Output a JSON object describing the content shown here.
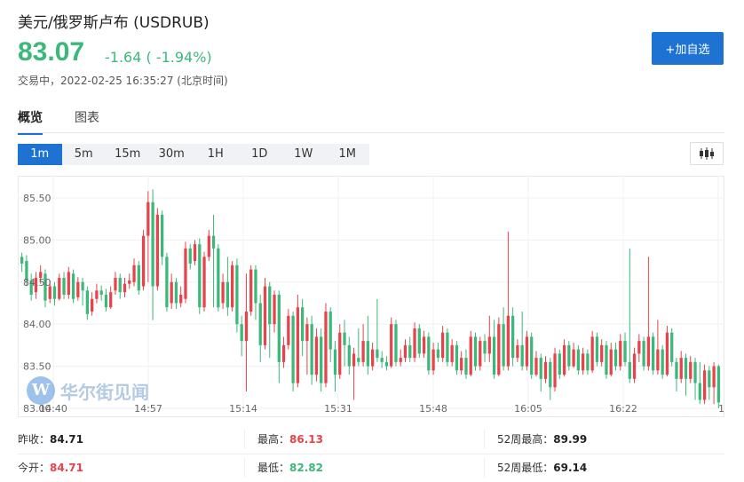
{
  "header": {
    "title": "美元/俄罗斯卢布  (USDRUB)",
    "price": "83.07",
    "change": "-1.64 ( -1.94%)",
    "status": "交易中，2022-02-25 16:35:27 (北京时间)",
    "add_button": "+加自选"
  },
  "tabs": [
    {
      "label": "概览",
      "active": true
    },
    {
      "label": "图表",
      "active": false
    }
  ],
  "periods": [
    {
      "label": "1m",
      "active": true
    },
    {
      "label": "5m",
      "active": false
    },
    {
      "label": "15m",
      "active": false
    },
    {
      "label": "30m",
      "active": false
    },
    {
      "label": "1H",
      "active": false
    },
    {
      "label": "1D",
      "active": false
    },
    {
      "label": "1W",
      "active": false
    },
    {
      "label": "1M",
      "active": false
    }
  ],
  "watermark": {
    "logo": "W",
    "text": "华尔街见闻"
  },
  "stats": {
    "prev_close_label": "昨收：",
    "prev_close": "84.71",
    "high_label": "最高：",
    "high": "86.13",
    "high52_label": "52周最高：",
    "high52": "89.99",
    "open_label": "今开：",
    "open": "84.71",
    "low_label": "最低：",
    "low": "82.82",
    "low52_label": "52周最低：",
    "low52": "69.14"
  },
  "colors": {
    "up": "#e8424a",
    "down": "#3bb87a",
    "accent": "#1e73d2"
  },
  "chart_data": {
    "type": "candlestick",
    "ylim": [
      83.0,
      85.7
    ],
    "y_ticks": [
      "85.50",
      "85.00",
      "84.50",
      "84.00",
      "83.50",
      "83.00"
    ],
    "x_ticks": [
      "14:40",
      "14:57",
      "15:14",
      "15:31",
      "15:48",
      "16:05",
      "16:22",
      "16:3"
    ],
    "grid": true,
    "candles": [
      [
        84.8,
        84.72,
        84.85,
        84.62
      ],
      [
        84.75,
        84.52,
        84.82,
        84.45
      ],
      [
        84.52,
        84.35,
        84.6,
        84.28
      ],
      [
        84.38,
        84.55,
        84.62,
        84.3
      ],
      [
        84.55,
        84.62,
        84.7,
        84.48
      ],
      [
        84.6,
        84.28,
        84.65,
        84.2
      ],
      [
        84.3,
        84.45,
        84.52,
        84.25
      ],
      [
        84.45,
        84.3,
        84.5,
        84.22
      ],
      [
        84.3,
        84.55,
        84.6,
        84.28
      ],
      [
        84.55,
        84.35,
        84.62,
        84.3
      ],
      [
        84.35,
        84.62,
        84.68,
        84.3
      ],
      [
        84.6,
        84.3,
        84.65,
        84.25
      ],
      [
        84.32,
        84.5,
        84.56,
        84.28
      ],
      [
        84.5,
        84.4,
        84.55,
        84.22
      ],
      [
        84.4,
        84.12,
        84.45,
        84.05
      ],
      [
        84.15,
        84.3,
        84.38,
        84.1
      ],
      [
        84.3,
        84.4,
        84.48,
        84.25
      ],
      [
        84.4,
        84.35,
        84.46,
        84.28
      ],
      [
        84.35,
        84.2,
        84.42,
        84.15
      ],
      [
        84.2,
        84.38,
        84.45,
        84.18
      ],
      [
        84.4,
        84.55,
        84.62,
        84.35
      ],
      [
        84.55,
        84.38,
        84.6,
        84.3
      ],
      [
        84.38,
        84.48,
        84.55,
        84.32
      ],
      [
        84.48,
        84.52,
        84.6,
        84.42
      ],
      [
        84.5,
        84.7,
        84.78,
        84.45
      ],
      [
        84.7,
        84.4,
        84.75,
        84.35
      ],
      [
        84.45,
        85.05,
        85.12,
        84.4
      ],
      [
        85.05,
        85.45,
        85.58,
        84.5
      ],
      [
        85.45,
        84.45,
        85.6,
        84.05
      ],
      [
        84.45,
        85.3,
        85.38,
        84.4
      ],
      [
        85.3,
        84.8,
        85.35,
        84.7
      ],
      [
        84.8,
        84.2,
        84.85,
        84.15
      ],
      [
        84.25,
        84.5,
        84.6,
        84.18
      ],
      [
        84.5,
        84.25,
        84.55,
        84.18
      ],
      [
        84.25,
        84.35,
        84.45,
        84.2
      ],
      [
        84.3,
        84.9,
        84.98,
        84.25
      ],
      [
        84.9,
        84.72,
        84.95,
        84.65
      ],
      [
        84.75,
        84.95,
        85.0,
        84.7
      ],
      [
        84.95,
        84.2,
        85.02,
        84.12
      ],
      [
        84.2,
        84.8,
        84.86,
        84.15
      ],
      [
        84.8,
        85.05,
        85.12,
        84.75
      ],
      [
        85.05,
        84.9,
        85.3,
        84.2
      ],
      [
        84.9,
        84.2,
        84.95,
        84.15
      ],
      [
        84.25,
        84.5,
        84.6,
        84.18
      ],
      [
        84.5,
        84.2,
        84.8,
        84.1
      ],
      [
        84.2,
        84.7,
        84.75,
        84.15
      ],
      [
        84.7,
        84.0,
        84.78,
        83.9
      ],
      [
        84.0,
        83.8,
        84.1,
        83.62
      ],
      [
        83.8,
        84.15,
        84.6,
        83.2
      ],
      [
        84.15,
        84.65,
        84.7,
        84.1
      ],
      [
        84.65,
        84.25,
        84.7,
        84.05
      ],
      [
        84.25,
        83.75,
        84.35,
        83.55
      ],
      [
        83.75,
        84.45,
        84.55,
        83.7
      ],
      [
        84.45,
        84.0,
        84.5,
        83.6
      ],
      [
        84.0,
        84.35,
        84.4,
        83.9
      ],
      [
        84.35,
        83.55,
        84.4,
        83.3
      ],
      [
        83.55,
        83.75,
        83.85,
        83.48
      ],
      [
        83.75,
        84.1,
        84.18,
        83.7
      ],
      [
        84.1,
        83.3,
        84.15,
        83.2
      ],
      [
        83.3,
        84.2,
        84.35,
        83.25
      ],
      [
        84.2,
        83.8,
        84.3,
        83.62
      ],
      [
        83.8,
        84.0,
        84.08,
        83.4
      ],
      [
        84.0,
        83.4,
        84.1,
        83.28
      ],
      [
        83.4,
        83.85,
        83.95,
        83.32
      ],
      [
        83.85,
        83.3,
        83.95,
        83.2
      ],
      [
        83.3,
        84.15,
        84.25,
        83.25
      ],
      [
        84.15,
        83.7,
        84.2,
        83.55
      ],
      [
        83.7,
        83.4,
        83.8,
        83.2
      ],
      [
        83.4,
        83.9,
        84.0,
        83.35
      ],
      [
        83.9,
        83.75,
        84.05,
        83.5
      ],
      [
        83.75,
        83.5,
        83.85,
        83.4
      ],
      [
        83.5,
        83.65,
        83.72,
        83.1
      ],
      [
        83.6,
        83.55,
        83.95,
        83.5
      ],
      [
        83.55,
        83.8,
        84.0,
        83.5
      ],
      [
        83.8,
        83.5,
        84.1,
        83.4
      ],
      [
        83.5,
        83.7,
        83.78,
        83.45
      ],
      [
        83.7,
        83.6,
        84.3,
        83.55
      ],
      [
        83.6,
        83.55,
        83.68,
        83.48
      ],
      [
        83.55,
        83.5,
        83.62,
        83.45
      ],
      [
        83.5,
        84.0,
        84.08,
        83.48
      ],
      [
        84.0,
        83.55,
        84.05,
        83.5
      ],
      [
        83.55,
        83.6,
        83.7,
        83.5
      ],
      [
        83.6,
        83.75,
        83.82,
        83.55
      ],
      [
        83.75,
        83.6,
        83.85,
        83.55
      ],
      [
        83.6,
        83.95,
        84.02,
        83.55
      ],
      [
        83.95,
        83.65,
        84.0,
        83.6
      ],
      [
        83.65,
        83.85,
        83.92,
        83.6
      ],
      [
        83.85,
        83.45,
        83.9,
        83.4
      ],
      [
        83.45,
        83.7,
        83.78,
        83.4
      ],
      [
        83.7,
        83.6,
        83.78,
        83.55
      ],
      [
        83.6,
        83.9,
        83.98,
        83.55
      ],
      [
        83.9,
        83.55,
        83.95,
        83.5
      ],
      [
        83.55,
        83.75,
        83.82,
        83.5
      ],
      [
        83.75,
        83.45,
        83.8,
        83.4
      ],
      [
        83.45,
        83.6,
        83.68,
        83.4
      ],
      [
        83.6,
        83.4,
        83.7,
        83.35
      ],
      [
        83.4,
        83.85,
        83.92,
        83.38
      ],
      [
        83.85,
        83.5,
        83.9,
        83.45
      ],
      [
        83.5,
        83.8,
        83.85,
        83.45
      ],
      [
        83.8,
        83.65,
        83.88,
        83.55
      ],
      [
        83.65,
        83.85,
        84.1,
        83.55
      ],
      [
        83.85,
        83.4,
        84.05,
        83.35
      ],
      [
        83.4,
        84.0,
        84.08,
        83.38
      ],
      [
        84.0,
        83.5,
        84.2,
        83.45
      ],
      [
        83.5,
        84.1,
        85.1,
        83.45
      ],
      [
        84.1,
        83.6,
        84.2,
        83.5
      ],
      [
        83.6,
        83.75,
        83.82,
        83.55
      ],
      [
        83.75,
        83.5,
        84.15,
        83.45
      ],
      [
        83.5,
        83.85,
        83.92,
        83.45
      ],
      [
        83.85,
        83.4,
        83.9,
        83.35
      ],
      [
        83.4,
        83.6,
        83.68,
        83.38
      ],
      [
        83.6,
        83.35,
        83.65,
        83.2
      ],
      [
        83.35,
        83.55,
        83.62,
        83.3
      ],
      [
        83.55,
        83.25,
        83.6,
        83.1
      ],
      [
        83.25,
        83.65,
        83.72,
        83.2
      ],
      [
        83.65,
        83.4,
        83.7,
        83.35
      ],
      [
        83.4,
        83.75,
        83.82,
        83.38
      ],
      [
        83.75,
        83.5,
        83.8,
        83.45
      ],
      [
        83.5,
        83.7,
        83.78,
        83.48
      ],
      [
        83.7,
        83.45,
        83.75,
        83.4
      ],
      [
        83.45,
        83.65,
        83.72,
        83.4
      ],
      [
        83.65,
        83.45,
        83.7,
        83.4
      ],
      [
        83.45,
        83.85,
        83.92,
        83.42
      ],
      [
        83.85,
        83.55,
        83.9,
        83.5
      ],
      [
        83.55,
        83.75,
        83.82,
        83.5
      ],
      [
        83.75,
        83.4,
        83.8,
        83.35
      ],
      [
        83.4,
        83.7,
        83.78,
        83.38
      ],
      [
        83.7,
        83.5,
        83.78,
        83.45
      ],
      [
        83.5,
        83.8,
        83.88,
        83.45
      ],
      [
        83.8,
        83.55,
        83.9,
        83.5
      ],
      [
        83.55,
        83.35,
        84.9,
        83.3
      ],
      [
        83.35,
        83.65,
        83.72,
        83.3
      ],
      [
        83.65,
        83.8,
        83.88,
        83.55
      ],
      [
        83.8,
        83.5,
        83.85,
        83.45
      ],
      [
        83.5,
        83.85,
        84.8,
        83.45
      ],
      [
        83.85,
        83.45,
        83.9,
        83.4
      ],
      [
        83.45,
        83.7,
        84.05,
        83.4
      ],
      [
        83.7,
        83.4,
        83.75,
        83.35
      ],
      [
        83.4,
        83.9,
        83.98,
        83.38
      ],
      [
        83.9,
        83.55,
        83.95,
        83.5
      ],
      [
        83.55,
        83.35,
        83.6,
        83.2
      ],
      [
        83.35,
        83.6,
        83.68,
        83.3
      ],
      [
        83.6,
        83.35,
        83.65,
        83.15
      ],
      [
        83.35,
        83.55,
        83.62,
        83.3
      ],
      [
        83.55,
        83.3,
        83.6,
        83.1
      ],
      [
        83.3,
        83.1,
        83.55,
        83.05
      ],
      [
        83.1,
        83.45,
        83.52,
        83.05
      ],
      [
        83.45,
        83.25,
        83.5,
        83.1
      ],
      [
        83.25,
        83.5,
        83.55,
        83.05
      ],
      [
        83.5,
        83.07,
        83.52,
        83.0
      ]
    ]
  }
}
